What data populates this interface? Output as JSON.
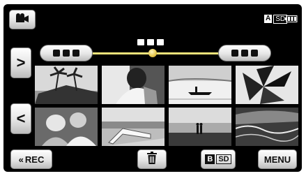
{
  "status": {
    "media_label_box": "A",
    "media_label_text": "SD",
    "battery_icon": "battery-icon"
  },
  "top": {
    "mode_icon": "video-camera-icon",
    "date_dots": 3
  },
  "timeline": {
    "left_pill_dots": 3,
    "right_pill_dots": 3,
    "slider_position": 0.5
  },
  "nav": {
    "next_glyph": ">",
    "prev_glyph": "<"
  },
  "thumbnails": [
    {
      "name": "palm-trees-beach",
      "row": 1,
      "col": 1
    },
    {
      "name": "woman-portrait",
      "row": 1,
      "col": 2
    },
    {
      "name": "boat-on-lake",
      "row": 1,
      "col": 3
    },
    {
      "name": "palm-leaves-silhouette",
      "row": 1,
      "col": 4
    },
    {
      "name": "children-playing",
      "row": 2,
      "col": 1
    },
    {
      "name": "beach-lounger",
      "row": 2,
      "col": 2
    },
    {
      "name": "couple-sunset-beach",
      "row": 2,
      "col": 3
    },
    {
      "name": "ocean-waves",
      "row": 2,
      "col": 4
    }
  ],
  "bottom": {
    "rec_label": "REC",
    "rec_glyph": "«",
    "delete_icon": "trash-icon",
    "media_b_box": "B",
    "media_b_text": "SD",
    "menu_label": "MENU"
  }
}
